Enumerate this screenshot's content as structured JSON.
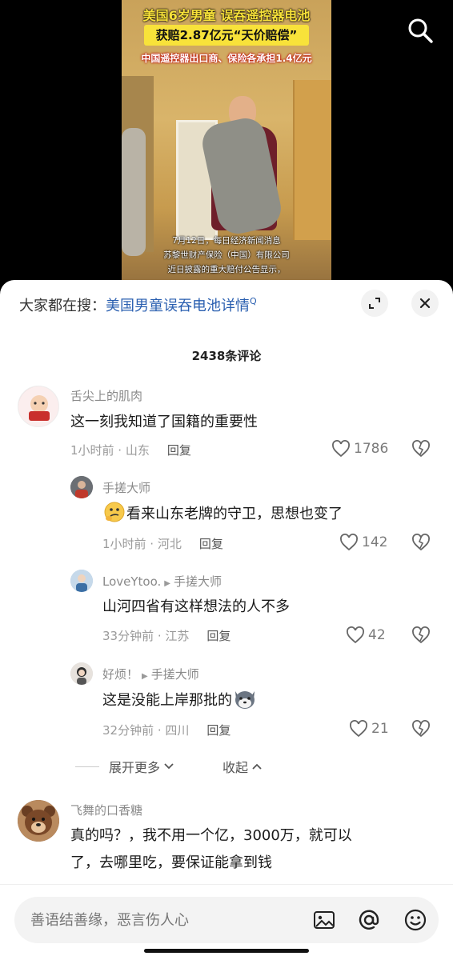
{
  "video": {
    "title_line1": "美国6岁男童 误吞遥控器电池",
    "title_line2": "获赔2.87亿元“天价赔偿”",
    "subtitle": "中国遥控器出口商、保险各承担1.4亿元",
    "caption": [
      "7月12日，每日经济新闻消息",
      "苏黎世财产保险（中国）有限公司",
      "近日披露的重大赔付公告显示，"
    ]
  },
  "hot_search": {
    "prefix": "大家都在搜：",
    "link": "美国男童误吞电池详情",
    "link_suffix": "Q"
  },
  "comment_count": "2438条评论",
  "comments": [
    {
      "name": "舌尖上的肌肉",
      "text": "这一刻我知道了国籍的重要性",
      "time": "1小时前 · 山东",
      "reply": "回复",
      "likes": "1786"
    },
    {
      "name": "手搓大师",
      "text": "看来山东老牌的守卫，思想也变了",
      "time": "1小时前 · 河北",
      "reply": "回复",
      "likes": "142"
    },
    {
      "name": "LoveYtoo.",
      "reply_to": "手搓大师",
      "text": "山河四省有这样想法的人不多",
      "time": "33分钟前 · 江苏",
      "reply": "回复",
      "likes": "42"
    },
    {
      "name": "好烦！",
      "reply_to": "手搓大师",
      "text": "这是没能上岸那批的",
      "time": "32分钟前 · 四川",
      "reply": "回复",
      "likes": "21"
    },
    {
      "name": "飞舞的口香糖",
      "text_lines": [
        "真的吗？，我不用一个亿，3000万，就可以",
        "了，去哪里吃，要保证能拿到钱"
      ]
    }
  ],
  "thread_controls": {
    "expand": "展开更多",
    "collapse": "收起"
  },
  "input": {
    "placeholder": "善语结善缘，恶言伤人心"
  },
  "colors": {
    "link_blue": "#2a5fb0",
    "caption_yellow": "#f8e23a"
  },
  "icons": [
    "search-icon",
    "expand-icon",
    "close-icon",
    "heart-icon",
    "dislike-icon",
    "image-icon",
    "at-icon",
    "emoji-icon"
  ]
}
